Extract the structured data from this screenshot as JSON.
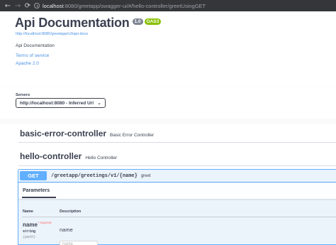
{
  "browser": {
    "back_icon": "arrow-left-icon",
    "forward_icon": "arrow-right-icon",
    "url_host": "localhost",
    "url_rest": ":8080/greetapp/swagger-ui/#/hello-controller/greetUsingGET"
  },
  "info": {
    "title": "Api Documentation",
    "version": "1.0",
    "spec_badge": "OAS3",
    "spec_url": "http://localhost:8080/greetapp/v3/api-docs",
    "description": "Api Documentation",
    "terms_link": "Terms of service",
    "license_link": "Apache 2.0"
  },
  "servers": {
    "label": "Servers",
    "selected": "http://localhost:8080 - Inferred Url"
  },
  "tags": [
    {
      "name": "basic-error-controller",
      "description": "Basic Error Controller"
    },
    {
      "name": "hello-controller",
      "description": "Hello Controller"
    }
  ],
  "operation": {
    "method": "GET",
    "path": "/greetapp/greetings/v1/{name}",
    "summary": "greet",
    "parameters_tab": "Parameters",
    "col_name": "Name",
    "col_description": "Description",
    "param": {
      "name": "name",
      "required": "* required",
      "type": "string",
      "in": "(path)",
      "description": "name",
      "placeholder": "name"
    }
  },
  "colors": {
    "get_blue": "#61affe",
    "oas_green": "#89bf04",
    "link_blue": "#4990e2",
    "required_red": "#ff6f6f"
  }
}
